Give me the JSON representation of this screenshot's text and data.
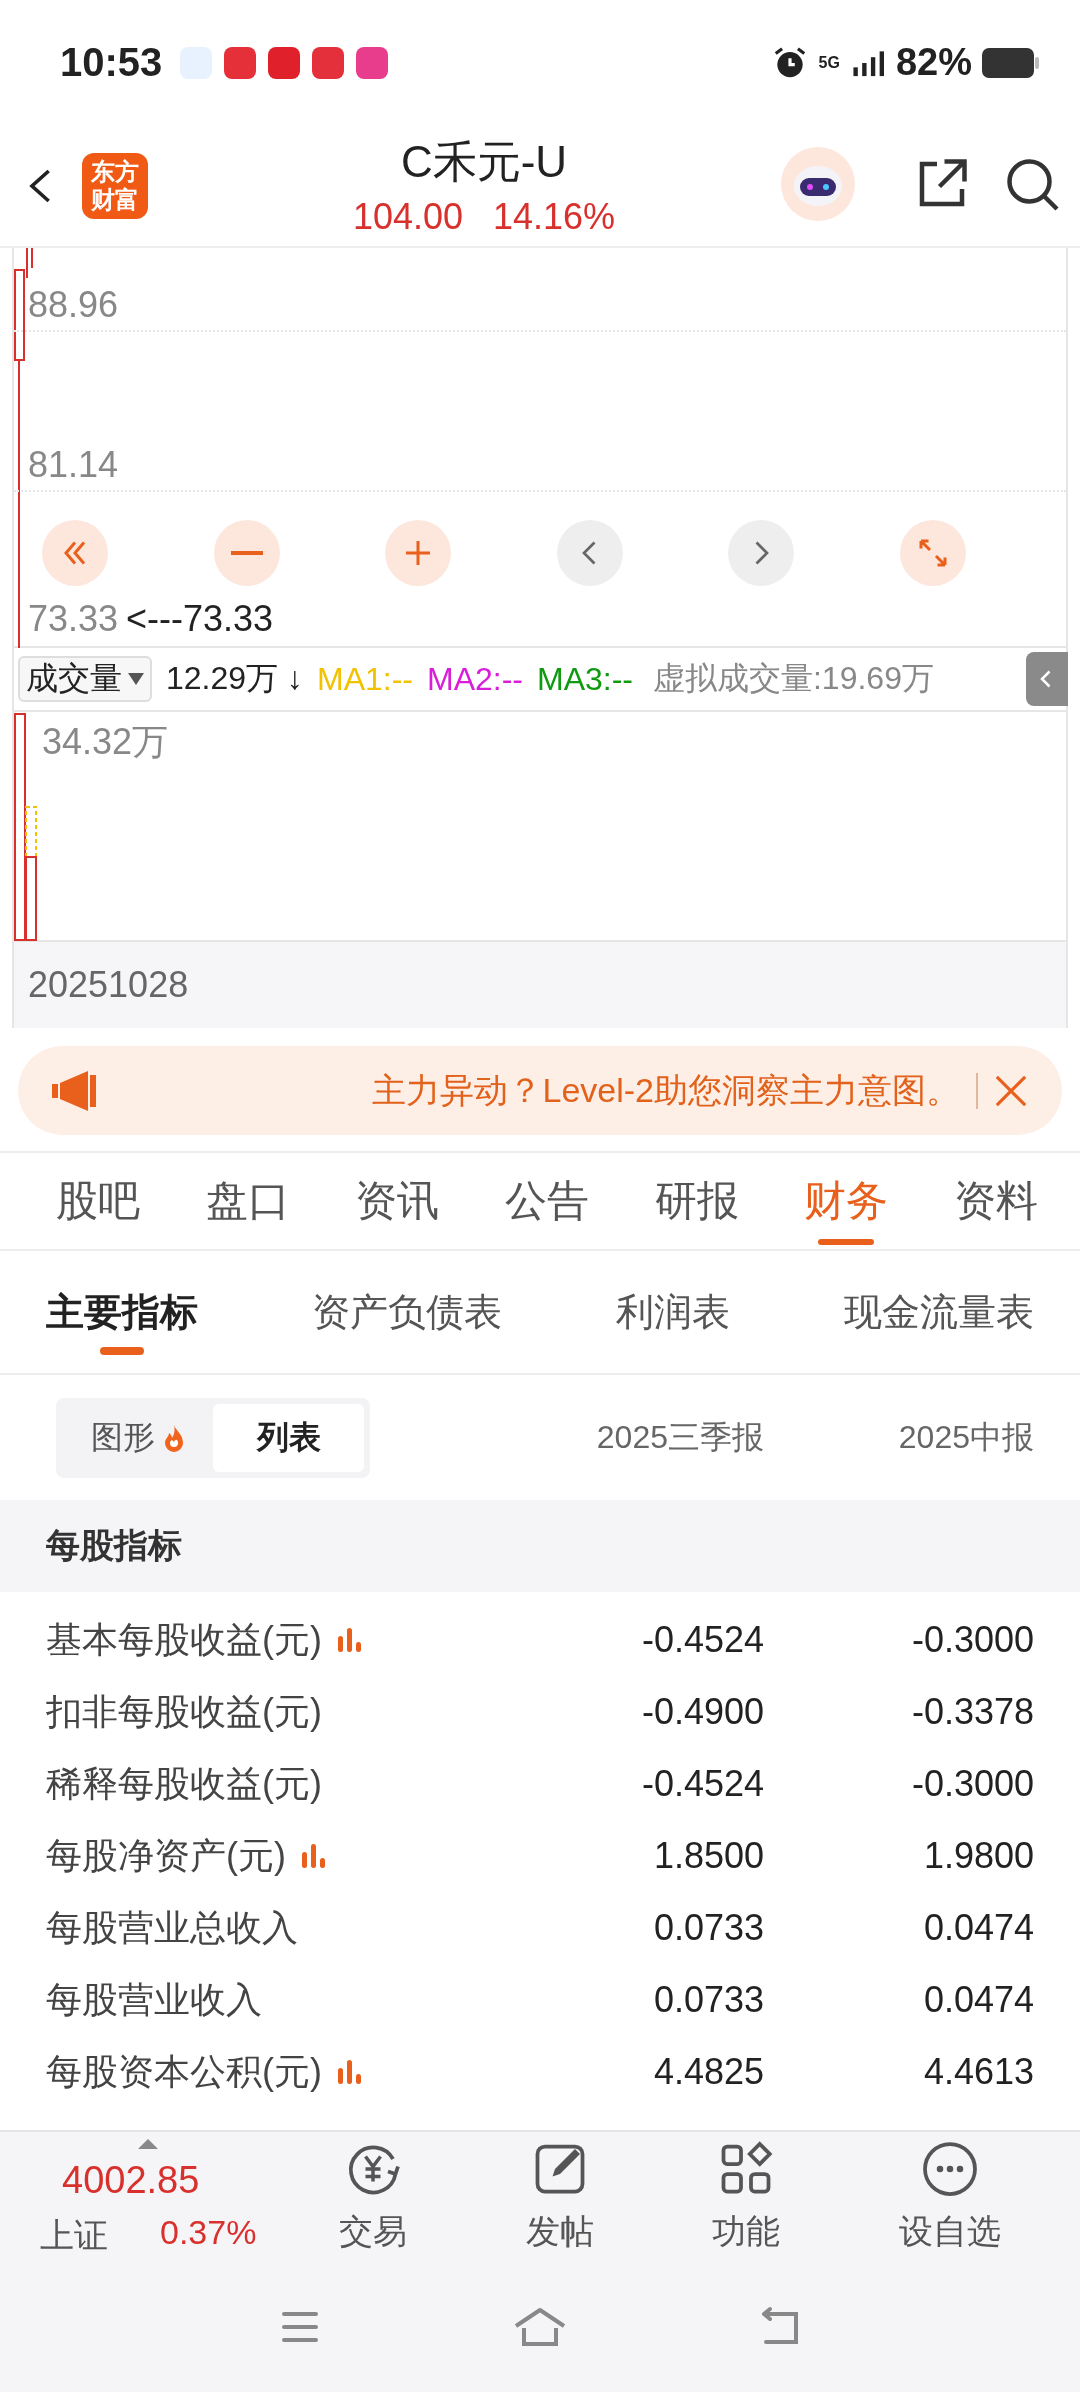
{
  "status_bar": {
    "time": "10:53",
    "network": "5G",
    "battery": "82%"
  },
  "header": {
    "logo": "东方财富",
    "title": "C禾元-U",
    "price": "104.00",
    "change": "14.16%"
  },
  "price_chart": {
    "labels": [
      "88.96",
      "81.14",
      "73.33"
    ],
    "marker": "<---73.33"
  },
  "chart_controls": [
    {
      "kind": "rewind",
      "disabled": false
    },
    {
      "kind": "zoom-out",
      "disabled": false
    },
    {
      "kind": "zoom-in",
      "disabled": false
    },
    {
      "kind": "prev",
      "disabled": true
    },
    {
      "kind": "next",
      "disabled": true
    },
    {
      "kind": "expand",
      "disabled": false
    }
  ],
  "volume_bar": {
    "selector": "成交量",
    "value": "12.29万 ↓",
    "ma": [
      {
        "label": "MA1:--",
        "color": "#f2c200"
      },
      {
        "label": "MA2:--",
        "color": "#d81ed8"
      },
      {
        "label": "MA3:--",
        "color": "#109a10"
      }
    ],
    "virtual": "虚拟成交量:19.69万"
  },
  "volume_chart": {
    "label": "34.32万"
  },
  "date": "20251028",
  "banner": {
    "text": "主力异动？Level-2助您洞察主力意图。"
  },
  "tabs": [
    {
      "label": "股吧",
      "selected": false
    },
    {
      "label": "盘口",
      "selected": false
    },
    {
      "label": "资讯",
      "selected": false
    },
    {
      "label": "公告",
      "selected": false
    },
    {
      "label": "研报",
      "selected": false
    },
    {
      "label": "财务",
      "selected": true
    },
    {
      "label": "资料",
      "selected": false
    }
  ],
  "sub_tabs": [
    {
      "label": "主要指标",
      "selected": true
    },
    {
      "label": "资产负债表",
      "selected": false
    },
    {
      "label": "利润表",
      "selected": false
    },
    {
      "label": "现金流量表",
      "selected": false
    }
  ],
  "view_toggle": [
    {
      "label": "图形",
      "selected": false,
      "hot": true
    },
    {
      "label": "列表",
      "selected": true,
      "hot": false
    }
  ],
  "columns": [
    "2025三季报",
    "2025中报"
  ],
  "section": "每股指标",
  "rows": [
    {
      "name": "基本每股收益(元)",
      "chart": true,
      "values": [
        "-0.4524",
        "-0.3000"
      ]
    },
    {
      "name": "扣非每股收益(元)",
      "chart": false,
      "values": [
        "-0.4900",
        "-0.3378"
      ]
    },
    {
      "name": "稀释每股收益(元)",
      "chart": false,
      "values": [
        "-0.4524",
        "-0.3000"
      ]
    },
    {
      "name": "每股净资产(元)",
      "chart": true,
      "values": [
        "1.8500",
        "1.9800"
      ]
    },
    {
      "name": "每股营业总收入",
      "chart": false,
      "values": [
        "0.0733",
        "0.0474"
      ]
    },
    {
      "name": "每股营业收入",
      "chart": false,
      "values": [
        "0.0733",
        "0.0474"
      ]
    },
    {
      "name": "每股资本公积(元)",
      "chart": true,
      "values": [
        "4.4825",
        "4.4613"
      ]
    }
  ],
  "index_ticker": {
    "name": "上证",
    "value": "4002.85",
    "change": "0.37%"
  },
  "bottom_nav": [
    {
      "kind": "trade",
      "label": "交易"
    },
    {
      "kind": "post",
      "label": "发帖"
    },
    {
      "kind": "functions",
      "label": "功能"
    },
    {
      "kind": "more",
      "label": "设自选"
    }
  ]
}
